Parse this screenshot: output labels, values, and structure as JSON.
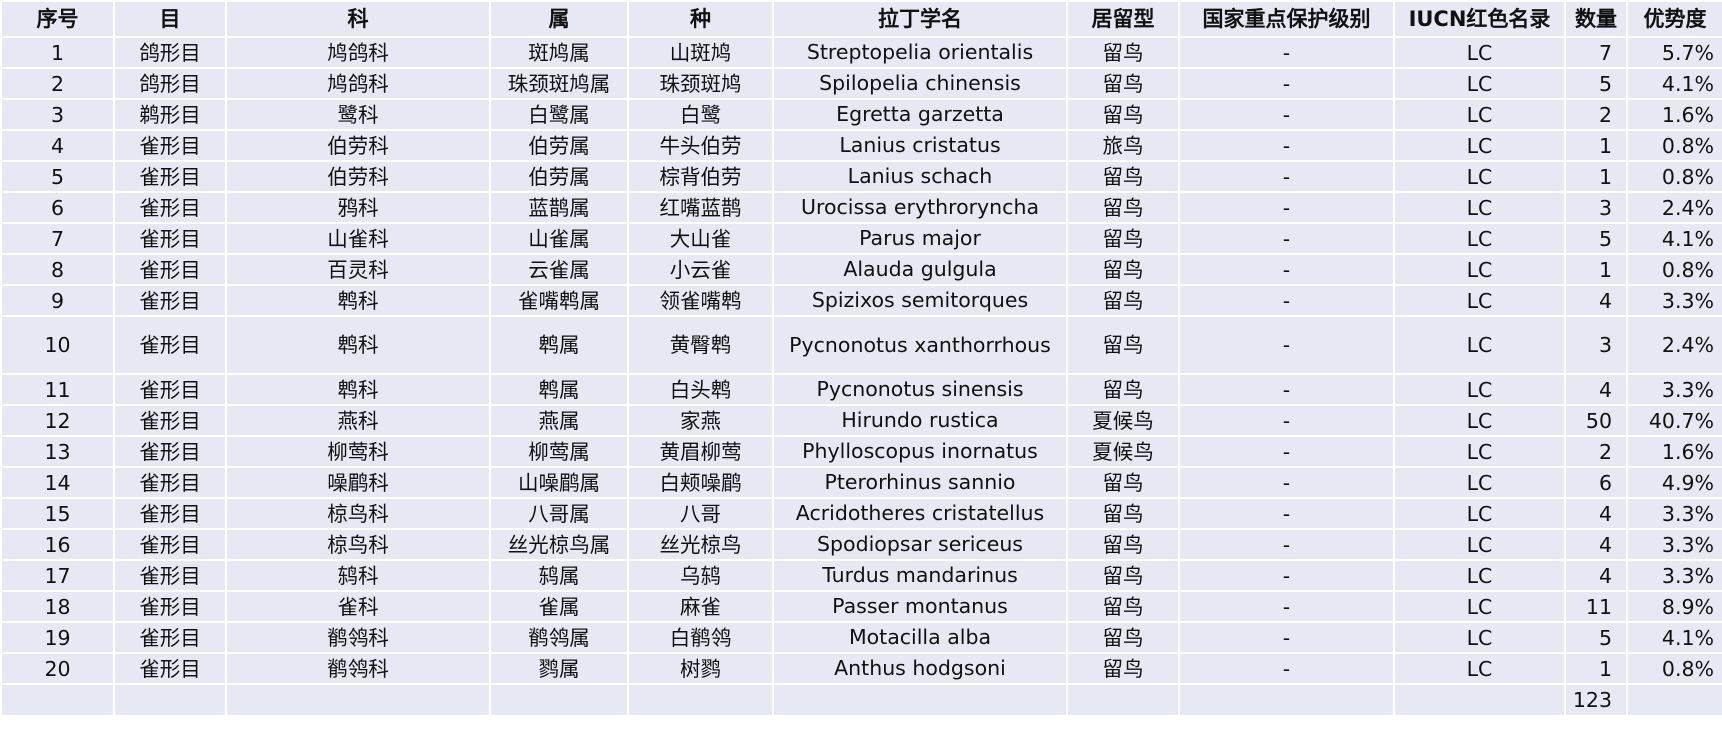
{
  "headers": [
    "序号",
    "目",
    "科",
    "属",
    "种",
    "拉丁学名",
    "居留型",
    "国家重点保护级别",
    "IUCN红色名录",
    "数量",
    "优势度"
  ],
  "rows": [
    [
      "1",
      "鸽形目",
      "鸠鸽科",
      "斑鸠属",
      "山斑鸠",
      "Streptopelia orientalis",
      "留鸟",
      "-",
      "LC",
      "7",
      "5.7%"
    ],
    [
      "2",
      "鸽形目",
      "鸠鸽科",
      "珠颈斑鸠属",
      "珠颈斑鸠",
      "Spilopelia chinensis",
      "留鸟",
      "-",
      "LC",
      "5",
      "4.1%"
    ],
    [
      "3",
      "鹈形目",
      "鹭科",
      "白鹭属",
      "白鹭",
      "Egretta garzetta",
      "留鸟",
      "-",
      "LC",
      "2",
      "1.6%"
    ],
    [
      "4",
      "雀形目",
      "伯劳科",
      "伯劳属",
      "牛头伯劳",
      "Lanius cristatus",
      "旅鸟",
      "-",
      "LC",
      "1",
      "0.8%"
    ],
    [
      "5",
      "雀形目",
      "伯劳科",
      "伯劳属",
      "棕背伯劳",
      "Lanius schach",
      "留鸟",
      "-",
      "LC",
      "1",
      "0.8%"
    ],
    [
      "6",
      "雀形目",
      "鸦科",
      "蓝鹊属",
      "红嘴蓝鹊",
      "Urocissa erythroryncha",
      "留鸟",
      "-",
      "LC",
      "3",
      "2.4%"
    ],
    [
      "7",
      "雀形目",
      "山雀科",
      "山雀属",
      "大山雀",
      "Parus major",
      "留鸟",
      "-",
      "LC",
      "5",
      "4.1%"
    ],
    [
      "8",
      "雀形目",
      "百灵科",
      "云雀属",
      "小云雀",
      "Alauda gulgula",
      "留鸟",
      "-",
      "LC",
      "1",
      "0.8%"
    ],
    [
      "9",
      "雀形目",
      "鹎科",
      "雀嘴鹎属",
      "领雀嘴鹎",
      "Spizixos semitorques",
      "留鸟",
      "-",
      "LC",
      "4",
      "3.3%"
    ],
    [
      "10",
      "雀形目",
      "鹎科",
      "鹎属",
      "黄臀鹎",
      "Pycnonotus xanthorrhous",
      "留鸟",
      "-",
      "LC",
      "3",
      "2.4%"
    ],
    [
      "11",
      "雀形目",
      "鹎科",
      "鹎属",
      "白头鹎",
      "Pycnonotus sinensis",
      "留鸟",
      "-",
      "LC",
      "4",
      "3.3%"
    ],
    [
      "12",
      "雀形目",
      "燕科",
      "燕属",
      "家燕",
      "Hirundo rustica",
      "夏候鸟",
      "-",
      "LC",
      "50",
      "40.7%"
    ],
    [
      "13",
      "雀形目",
      "柳莺科",
      "柳莺属",
      "黄眉柳莺",
      "Phylloscopus inornatus",
      "夏候鸟",
      "-",
      "LC",
      "2",
      "1.6%"
    ],
    [
      "14",
      "雀形目",
      "噪鹛科",
      "山噪鹛属",
      "白颊噪鹛",
      "Pterorhinus sannio",
      "留鸟",
      "-",
      "LC",
      "6",
      "4.9%"
    ],
    [
      "15",
      "雀形目",
      "椋鸟科",
      "八哥属",
      "八哥",
      "Acridotheres cristatellus",
      "留鸟",
      "-",
      "LC",
      "4",
      "3.3%"
    ],
    [
      "16",
      "雀形目",
      "椋鸟科",
      "丝光椋鸟属",
      "丝光椋鸟",
      "Spodiopsar sericeus",
      "留鸟",
      "-",
      "LC",
      "4",
      "3.3%"
    ],
    [
      "17",
      "雀形目",
      "鸫科",
      "鸫属",
      "乌鸫",
      "Turdus mandarinus",
      "留鸟",
      "-",
      "LC",
      "4",
      "3.3%"
    ],
    [
      "18",
      "雀形目",
      "雀科",
      "雀属",
      "麻雀",
      "Passer montanus",
      "留鸟",
      "-",
      "LC",
      "11",
      "8.9%"
    ],
    [
      "19",
      "雀形目",
      "鹡鸰科",
      "鹡鸰属",
      "白鹡鸰",
      "Motacilla alba",
      "留鸟",
      "-",
      "LC",
      "5",
      "4.1%"
    ],
    [
      "20",
      "雀形目",
      "鹡鸰科",
      "鹨属",
      "树鹨",
      "Anthus hodgsoni",
      "留鸟",
      "-",
      "LC",
      "1",
      "0.8%"
    ]
  ],
  "total": "123"
}
